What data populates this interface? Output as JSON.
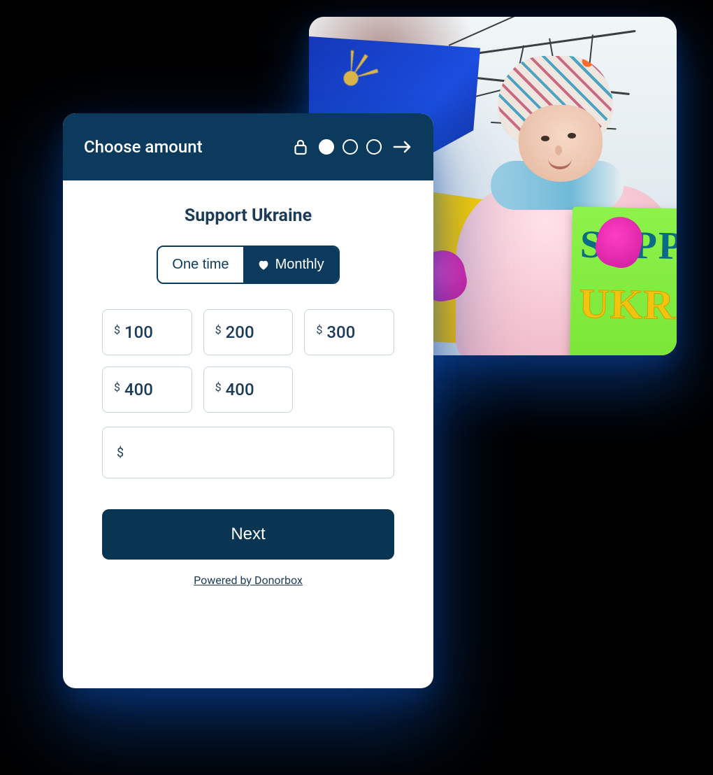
{
  "photo": {
    "sign_line1": "SUPPORT",
    "sign_line2": "UKRAINE"
  },
  "card": {
    "header": {
      "title": "Choose amount",
      "steps_total": 3,
      "current_step": 1
    },
    "campaign_title": "Support Ukraine",
    "frequency": {
      "one_time_label": "One time",
      "monthly_label": "Monthly",
      "selected": "monthly"
    },
    "currency_symbol": "$",
    "amounts": [
      "100",
      "200",
      "300",
      "400",
      "400"
    ],
    "custom_amount": {
      "value": "",
      "currency": "$"
    },
    "next_label": "Next",
    "powered_by": "Powered by Donorbox"
  },
  "colors": {
    "navy": "#0b3a5c",
    "accent_blue_shadow": "#0b47a3"
  }
}
